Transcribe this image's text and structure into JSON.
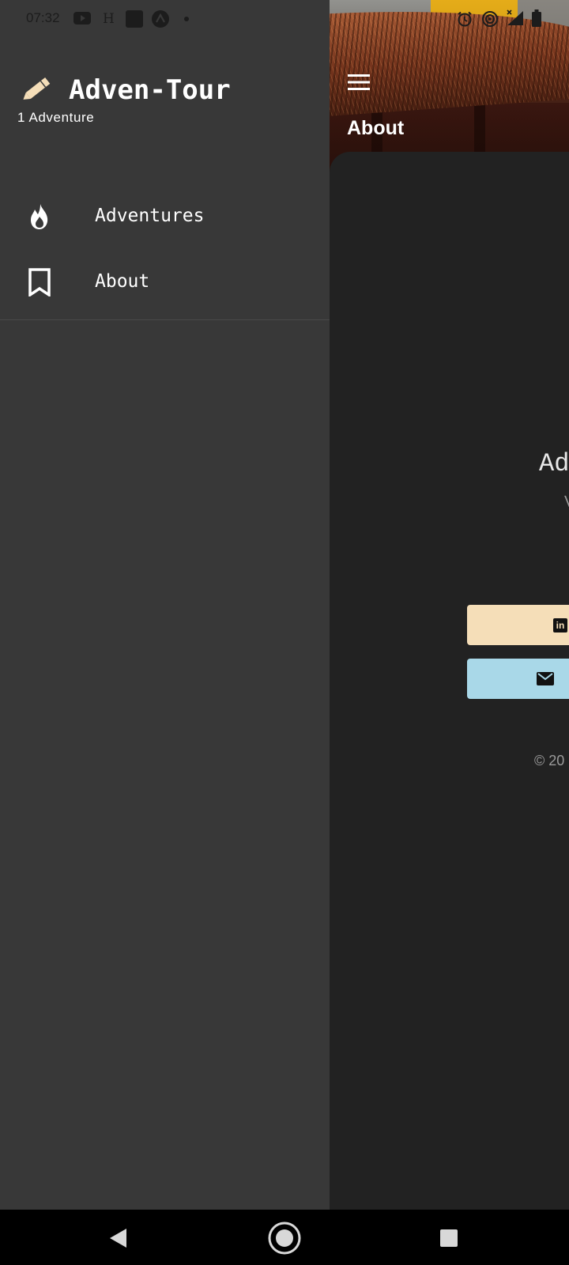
{
  "status_bar": {
    "time": "07:32",
    "left_icons": [
      "youtube-icon",
      "h-icon",
      "square-app-icon",
      "caret-circle-icon",
      "dot-icon"
    ],
    "h_glyph": "H",
    "right_icons": [
      "alarm-icon",
      "hotspot-icon",
      "signal-icon",
      "battery-icon"
    ]
  },
  "drawer": {
    "header_icon": "pencil-icon",
    "title": "Adven-Tour",
    "subtitle": "1 Adventure",
    "items": [
      {
        "label": "Adventures",
        "icon": "flame-icon"
      },
      {
        "label": "About",
        "icon": "bookmark-icon"
      }
    ]
  },
  "page": {
    "title": "About",
    "menu_icon": "hamburger-menu-icon",
    "app_name_fragment": "Ad",
    "version_fragment": "V",
    "linkedin_icon_text": "in",
    "copyright_fragment": "© 20"
  },
  "colors": {
    "drawer_bg": "#383838",
    "page_bg": "#222222",
    "accent_wheat": "#F5DEB8",
    "accent_lightblue": "#A9D8E8"
  },
  "system_nav": {
    "icons": [
      "back-icon",
      "home-icon",
      "recents-icon"
    ]
  }
}
